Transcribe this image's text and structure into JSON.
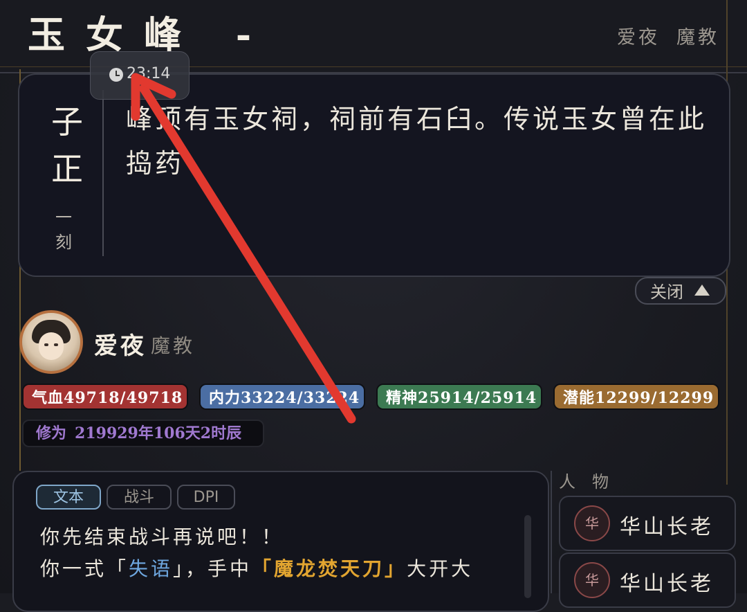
{
  "header": {
    "location_title": "玉女峰 -",
    "player_name": "爱夜",
    "player_faction": "魔教"
  },
  "time": {
    "icon": "clock-icon",
    "value": "23:14"
  },
  "description": {
    "side_top1": "子",
    "side_top2": "正",
    "side_small1": "一",
    "side_small2": "刻",
    "text": "峰顶有玉女祠，祠前有石臼。传说玉女曾在此捣药"
  },
  "close_button": {
    "label": "关闭",
    "icon": "triangle-up-icon"
  },
  "player": {
    "name": "爱夜",
    "faction": "魔教",
    "stats": {
      "hp_label": "气血",
      "hp_value": "49718/49718",
      "mp_label": "内力",
      "mp_value": "33224/33224",
      "sp_label": "精神",
      "sp_value": "25914/25914",
      "pot_label": "潜能",
      "pot_value": "12299/12299"
    },
    "cultivation_label": "修为",
    "cultivation_value": "219929年106天2时辰"
  },
  "log": {
    "tabs": [
      {
        "label": "文本",
        "active": true
      },
      {
        "label": "战斗",
        "active": false
      },
      {
        "label": "DPI",
        "active": false
      }
    ],
    "line1": "你先结束战斗再说吧！！",
    "line2_pre": "你一式「",
    "line2_skill": "失语",
    "line2_mid": "」，手中",
    "line2_weapon": "「魔龙焚天刀」",
    "line2_post": "大开大"
  },
  "people": {
    "header": "人物",
    "items": [
      {
        "badge": "华",
        "name": "华山长老"
      },
      {
        "badge": "华",
        "name": "华山长老"
      }
    ]
  },
  "colors": {
    "hp": "#a33332",
    "mp": "#4b6ea3",
    "sp": "#3c7a52",
    "potential": "#9a6b31",
    "cultivation": "#a079d0",
    "annotation_arrow": "#e2392f"
  }
}
